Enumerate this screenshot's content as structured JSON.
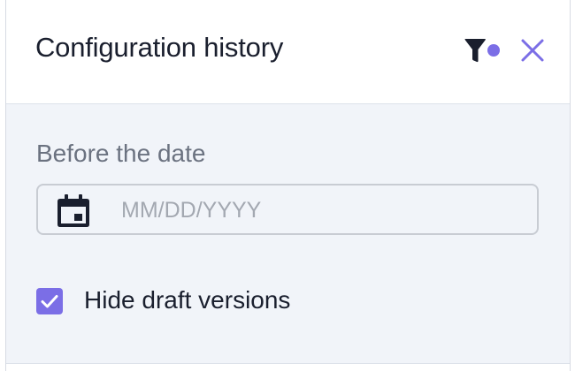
{
  "panel": {
    "title": "Configuration history",
    "filter_icon": "filter-icon",
    "filter_active_dot_color": "#7b6ee6",
    "close_icon": "close-icon",
    "accent_color": "#7b6ee6"
  },
  "filters": {
    "before_date_label": "Before the date",
    "date_input": {
      "value": "",
      "placeholder": "MM/DD/YYYY",
      "icon": "calendar-icon"
    },
    "hide_drafts": {
      "label": "Hide draft versions",
      "checked": true
    }
  }
}
